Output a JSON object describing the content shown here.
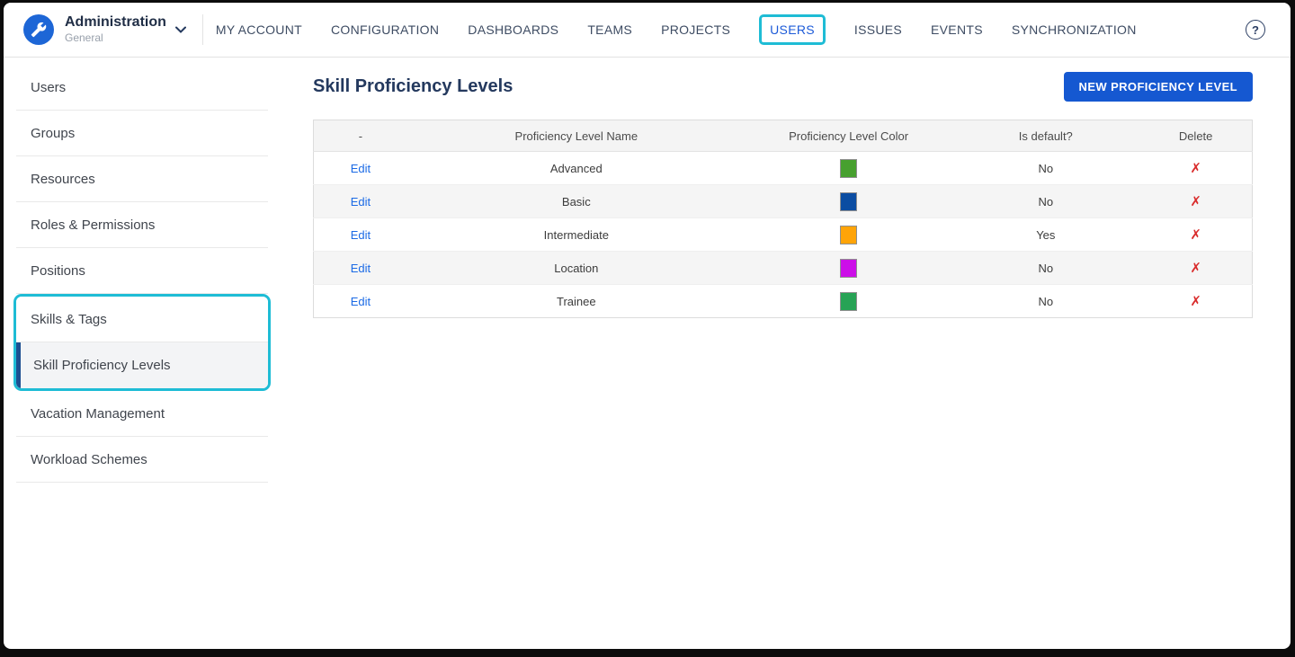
{
  "brand": {
    "title": "Administration",
    "subtitle": "General"
  },
  "nav": {
    "items": [
      {
        "label": "MY ACCOUNT",
        "active": false
      },
      {
        "label": "CONFIGURATION",
        "active": false
      },
      {
        "label": "DASHBOARDS",
        "active": false
      },
      {
        "label": "TEAMS",
        "active": false
      },
      {
        "label": "PROJECTS",
        "active": false
      },
      {
        "label": "USERS",
        "active": true
      },
      {
        "label": "ISSUES",
        "active": false
      },
      {
        "label": "EVENTS",
        "active": false
      },
      {
        "label": "SYNCHRONIZATION",
        "active": false
      }
    ],
    "help_glyph": "?"
  },
  "sidebar": {
    "items": [
      {
        "label": "Users"
      },
      {
        "label": "Groups"
      },
      {
        "label": "Resources"
      },
      {
        "label": "Roles & Permissions"
      },
      {
        "label": "Positions"
      },
      {
        "label": "Skills & Tags",
        "highlighted": true
      },
      {
        "label": "Skill Proficiency Levels",
        "highlighted": true,
        "selected": true,
        "sub": true
      },
      {
        "label": "Vacation Management"
      },
      {
        "label": "Workload Schemes"
      }
    ]
  },
  "main": {
    "title": "Skill Proficiency Levels",
    "new_button_label": "NEW PROFICIENCY LEVEL",
    "table": {
      "columns": [
        "-",
        "Proficiency Level Name",
        "Proficiency Level Color",
        "Is default?",
        "Delete"
      ],
      "delete_glyph": "✗",
      "rows": [
        {
          "edit_label": "Edit",
          "name": "Advanced",
          "color": "#47A02F",
          "is_default": "No"
        },
        {
          "edit_label": "Edit",
          "name": "Basic",
          "color": "#0B4DA2",
          "is_default": "No"
        },
        {
          "edit_label": "Edit",
          "name": "Intermediate",
          "color": "#FFA408",
          "is_default": "Yes"
        },
        {
          "edit_label": "Edit",
          "name": "Location",
          "color": "#CC0FE8",
          "is_default": "No"
        },
        {
          "edit_label": "Edit",
          "name": "Trainee",
          "color": "#27A355",
          "is_default": "No"
        }
      ]
    }
  },
  "colors": {
    "highlight_cyan": "#1EBCD5",
    "primary_button_blue": "#1558D1",
    "active_nav_blue": "#1D5BD8",
    "selected_bar_blue": "#1D4F91",
    "delete_red": "#D92B2B",
    "title_navy": "#24395E",
    "logo_blue": "#1D66D6"
  }
}
